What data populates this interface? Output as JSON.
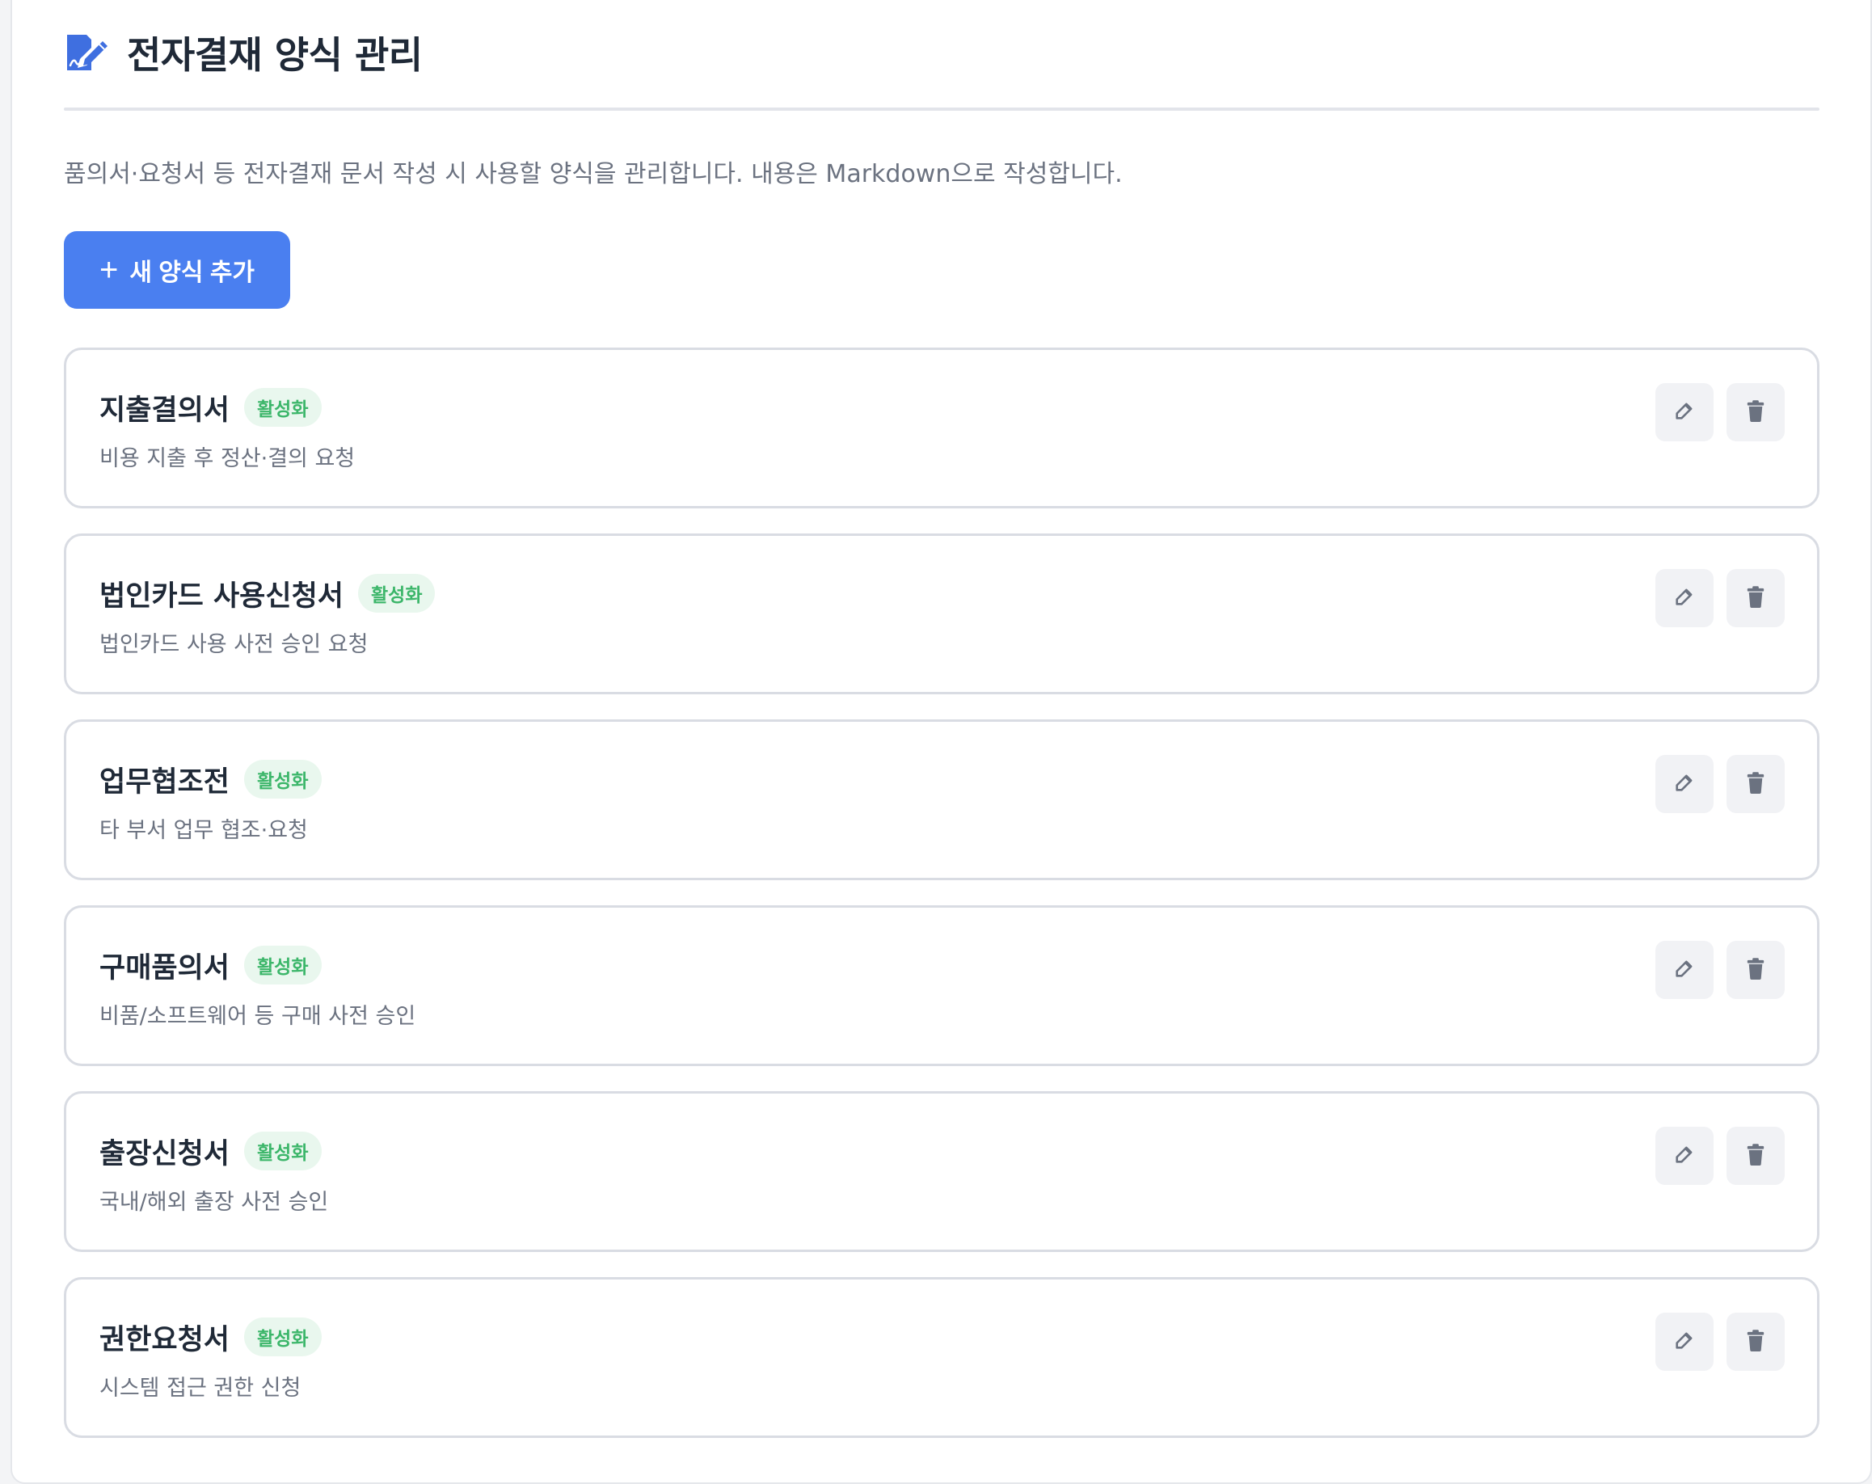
{
  "page": {
    "title": "전자결재 양식 관리",
    "title_icon": "document-signature-icon",
    "description": "품의서·요청서 등 전자결재 문서 작성 시 사용할 양식을 관리합니다. 내용은 Markdown으로 작성합니다."
  },
  "toolbar": {
    "add_label": "새 양식 추가",
    "add_icon": "plus-icon"
  },
  "colors": {
    "accent": "#4a7ff0",
    "badge_text": "#3cb66a",
    "badge_bg": "#e9f7ee"
  },
  "forms": [
    {
      "name": "지출결의서",
      "status": "활성화",
      "description": "비용 지출 후 정산·결의 요청"
    },
    {
      "name": "법인카드 사용신청서",
      "status": "활성화",
      "description": "법인카드 사용 사전 승인 요청"
    },
    {
      "name": "업무협조전",
      "status": "활성화",
      "description": "타 부서 업무 협조·요청"
    },
    {
      "name": "구매품의서",
      "status": "활성화",
      "description": "비품/소프트웨어 등 구매 사전 승인"
    },
    {
      "name": "출장신청서",
      "status": "활성화",
      "description": "국내/해외 출장 사전 승인"
    },
    {
      "name": "권한요청서",
      "status": "활성화",
      "description": "시스템 접근 권한 신청"
    }
  ],
  "actions": {
    "edit_icon": "edit-icon",
    "delete_icon": "trash-icon"
  }
}
